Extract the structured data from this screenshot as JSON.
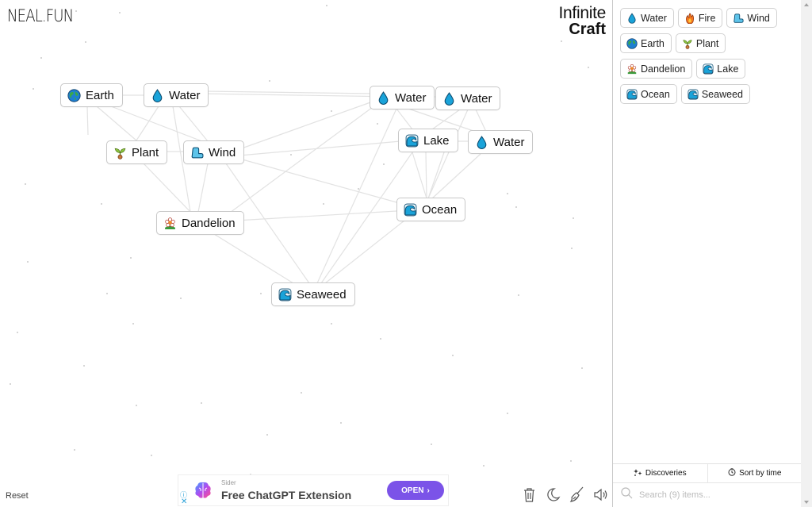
{
  "header": {
    "logo": "NEAL.FUN",
    "title_line1": "Infinite",
    "title_line2": "Craft"
  },
  "canvas": {
    "nodes": [
      {
        "label": "Earth",
        "icon": "earth-globe-icon"
      },
      {
        "label": "Water",
        "icon": "water-drop-icon"
      },
      {
        "label": "Plant",
        "icon": "seedling-icon"
      },
      {
        "label": "Wind",
        "icon": "wind-icon"
      },
      {
        "label": "Dandelion",
        "icon": "flower-icon"
      },
      {
        "label": "Water",
        "icon": "water-drop-icon"
      },
      {
        "label": "Water",
        "icon": "water-drop-icon"
      },
      {
        "label": "Lake",
        "icon": "wave-icon"
      },
      {
        "label": "Water",
        "icon": "water-drop-icon"
      },
      {
        "label": "Ocean",
        "icon": "wave-icon"
      },
      {
        "label": "Seaweed",
        "icon": "wave-icon"
      }
    ],
    "reset_label": "Reset"
  },
  "toolbar": {
    "tools": [
      {
        "name": "trash-icon"
      },
      {
        "name": "dark-mode-icon"
      },
      {
        "name": "broom-icon"
      },
      {
        "name": "sound-icon"
      }
    ]
  },
  "ad": {
    "brand": "Sider",
    "headline": "Free ChatGPT Extension",
    "cta": "OPEN",
    "cta_arrow": "›",
    "info_glyph": "ⓘ",
    "close_glyph": "✕"
  },
  "sidebar": {
    "items": [
      {
        "label": "Water",
        "icon": "water-drop-icon"
      },
      {
        "label": "Fire",
        "icon": "fire-icon"
      },
      {
        "label": "Wind",
        "icon": "wind-icon"
      },
      {
        "label": "Earth",
        "icon": "earth-globe-icon"
      },
      {
        "label": "Plant",
        "icon": "seedling-icon"
      },
      {
        "label": "Dandelion",
        "icon": "flower-icon"
      },
      {
        "label": "Lake",
        "icon": "wave-icon"
      },
      {
        "label": "Ocean",
        "icon": "wave-icon"
      },
      {
        "label": "Seaweed",
        "icon": "wave-icon"
      }
    ],
    "tabs": {
      "discoveries": "Discoveries",
      "sort": "Sort by time"
    },
    "search": {
      "placeholder": "Search (9) items...",
      "value": ""
    }
  },
  "colors": {
    "accent_purple": "#7b53e8",
    "water_blue": "#1aa3d9",
    "border_gray": "#c8c8c8"
  }
}
